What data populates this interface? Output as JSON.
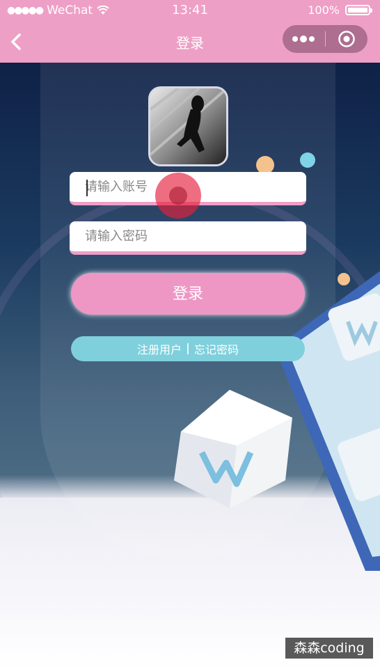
{
  "status_bar": {
    "carrier": "WeChat",
    "time": "13:41",
    "battery": "100%",
    "battery_level": 1.0
  },
  "nav": {
    "title": "登录"
  },
  "form": {
    "account_placeholder": "请输入账号",
    "password_placeholder": "请输入密码",
    "login_label": "登录"
  },
  "links": {
    "register": "注册用户",
    "forgot": "忘记密码"
  },
  "watermark": "森森coding",
  "colors": {
    "accent_pink": "#ee9fc6",
    "link_bar_cyan": "#7fd0dc"
  }
}
